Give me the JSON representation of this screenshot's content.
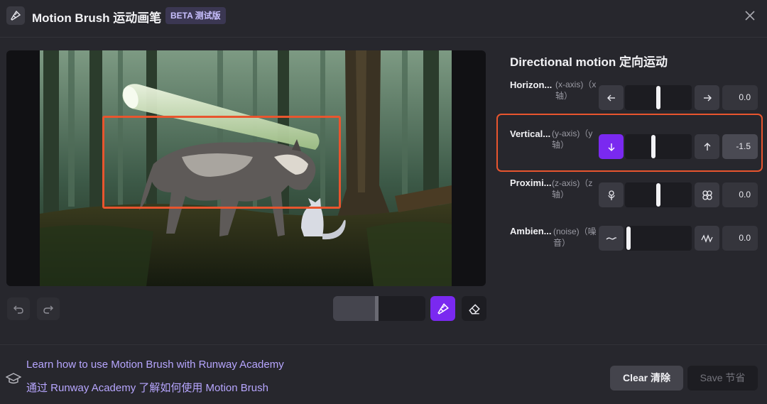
{
  "header": {
    "title": "Motion Brush 运动画笔",
    "badge": "BETA 测试版",
    "app_icon": "brush-icon",
    "close_icon": "close-icon"
  },
  "canvas": {
    "selection_color": "#e8552e"
  },
  "toolbar": {
    "undo_icon": "undo-icon",
    "redo_icon": "redo-icon",
    "brush_size": 0.48,
    "brush_icon": "brush-icon",
    "eraser_icon": "eraser-icon",
    "accent": "#7a29f0"
  },
  "panel": {
    "title": "Directional motion 定向运动",
    "rows": [
      {
        "label": "Horizon...",
        "sub": "(x-axis)（x轴）",
        "value": "0.0",
        "level": 0.5
      },
      {
        "label": "Vertical...",
        "sub": "(y-axis)（y轴）",
        "value": "-1.5",
        "level": 0.42
      },
      {
        "label": "Proximi...",
        "sub": "(z-axis)（z轴）",
        "value": "0.0",
        "level": 0.5
      },
      {
        "label": "Ambien...",
        "sub": "(noise)（噪音）",
        "value": "0.0",
        "level": 0.0
      }
    ]
  },
  "footer": {
    "learn_en": "Learn how to use Motion Brush with Runway Academy",
    "learn_zh": "通过 Runway Academy 了解如何使用 Motion Brush",
    "clear_label": "Clear  清除",
    "save_label": "Save  节省"
  }
}
